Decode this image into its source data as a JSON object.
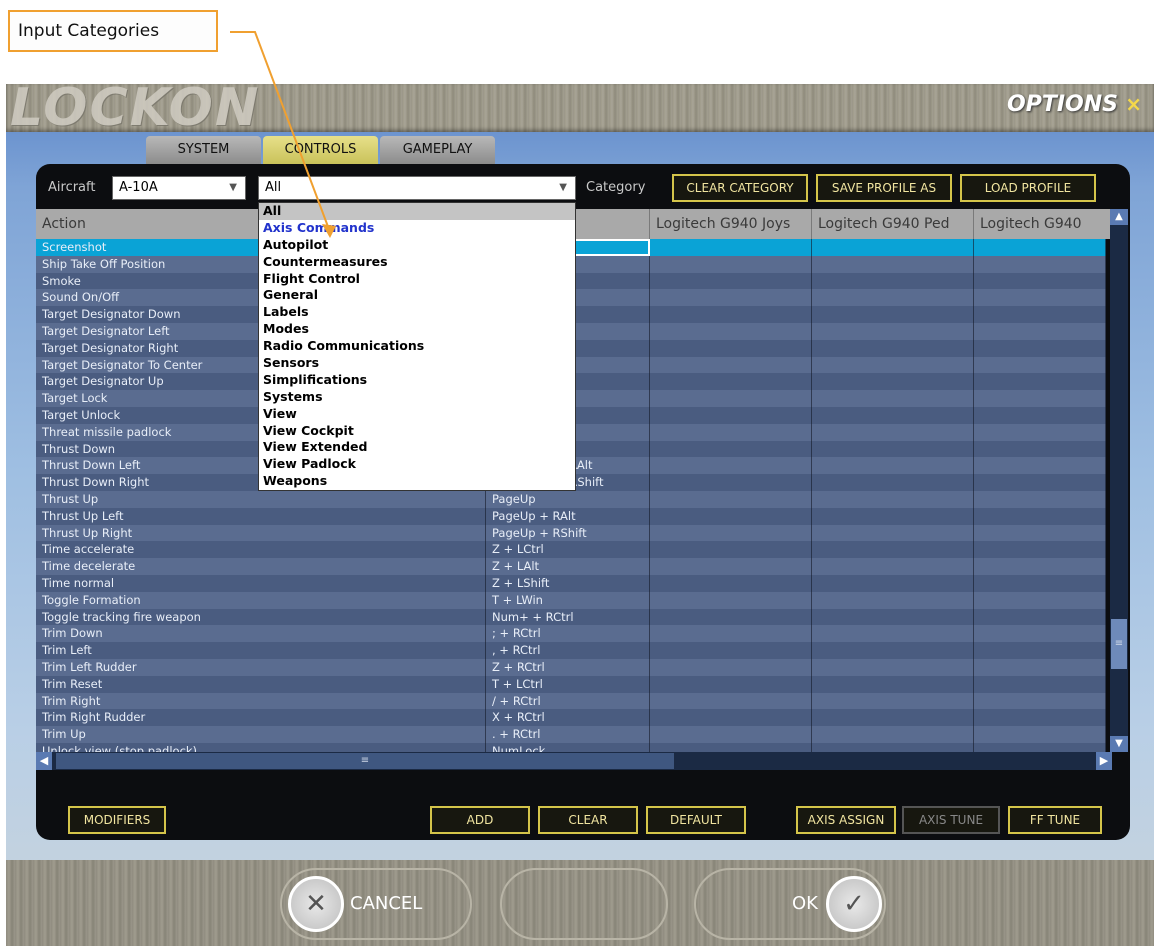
{
  "callout": {
    "label": "Input Categories"
  },
  "header": {
    "logo": "LOCKON",
    "title": "OPTIONS",
    "close": "×"
  },
  "tabs": [
    {
      "label": "SYSTEM"
    },
    {
      "label": "CONTROLS"
    },
    {
      "label": "GAMEPLAY"
    }
  ],
  "filters": {
    "aircraft_label": "Aircraft",
    "aircraft_value": "A-10A",
    "category_value": "All",
    "category_label": "Category",
    "clear_category": "CLEAR CATEGORY",
    "save_profile": "SAVE PROFILE AS",
    "load_profile": "LOAD PROFILE"
  },
  "table": {
    "columns": [
      "Action",
      "",
      "Logitech G940 Joys",
      "Logitech G940 Ped",
      "Logitech G940"
    ],
    "rows": [
      {
        "action": "Screenshot",
        "key": ""
      },
      {
        "action": "Ship Take Off Position",
        "key": ""
      },
      {
        "action": "Smoke",
        "key": ""
      },
      {
        "action": "Sound On/Off",
        "key": ""
      },
      {
        "action": "Target Designator Down",
        "key": ""
      },
      {
        "action": "Target Designator Left",
        "key": ""
      },
      {
        "action": "Target Designator Right",
        "key": ""
      },
      {
        "action": "Target Designator To Center",
        "key": ""
      },
      {
        "action": "Target Designator Up",
        "key": ""
      },
      {
        "action": "Target Lock",
        "key": ""
      },
      {
        "action": "Target Unlock",
        "key": ""
      },
      {
        "action": "Threat missile padlock",
        "key": ""
      },
      {
        "action": "Thrust Down",
        "key": ""
      },
      {
        "action": "Thrust Down Left",
        "key": "PageDown + RAlt"
      },
      {
        "action": "Thrust Down Right",
        "key": "PageDown + RShift"
      },
      {
        "action": "Thrust Up",
        "key": "PageUp"
      },
      {
        "action": "Thrust Up Left",
        "key": "PageUp + RAlt"
      },
      {
        "action": "Thrust Up Right",
        "key": "PageUp + RShift"
      },
      {
        "action": "Time accelerate",
        "key": "Z + LCtrl"
      },
      {
        "action": "Time decelerate",
        "key": "Z + LAlt"
      },
      {
        "action": "Time normal",
        "key": "Z + LShift"
      },
      {
        "action": "Toggle Formation",
        "key": "T + LWin"
      },
      {
        "action": "Toggle tracking fire weapon",
        "key": "Num+ + RCtrl"
      },
      {
        "action": "Trim Down",
        "key": "; + RCtrl"
      },
      {
        "action": "Trim Left",
        "key": ", + RCtrl"
      },
      {
        "action": "Trim Left Rudder",
        "key": "Z + RCtrl"
      },
      {
        "action": "Trim Reset",
        "key": "T + LCtrl"
      },
      {
        "action": "Trim Right",
        "key": "/ + RCtrl"
      },
      {
        "action": "Trim Right Rudder",
        "key": "X + RCtrl"
      },
      {
        "action": "Trim Up",
        "key": ". + RCtrl"
      },
      {
        "action": "Unlock view (stop padlock)",
        "key": "NumLock"
      }
    ]
  },
  "dropdown": {
    "items": [
      "All",
      "Axis Commands",
      "Autopilot",
      "Countermeasures",
      "Flight Control",
      "General",
      "Labels",
      "Modes",
      "Radio Communications",
      "Sensors",
      "Simplifications",
      "Systems",
      "View",
      "View Cockpit",
      "View Extended",
      "View Padlock",
      "Weapons"
    ]
  },
  "buttons": {
    "modifiers": "MODIFIERS",
    "add": "ADD",
    "clear": "CLEAR",
    "default": "DEFAULT",
    "axis_assign": "AXIS ASSIGN",
    "axis_tune": "AXIS TUNE",
    "ff_tune": "FF TUNE"
  },
  "footer": {
    "cancel": "CANCEL",
    "ok": "OK"
  }
}
